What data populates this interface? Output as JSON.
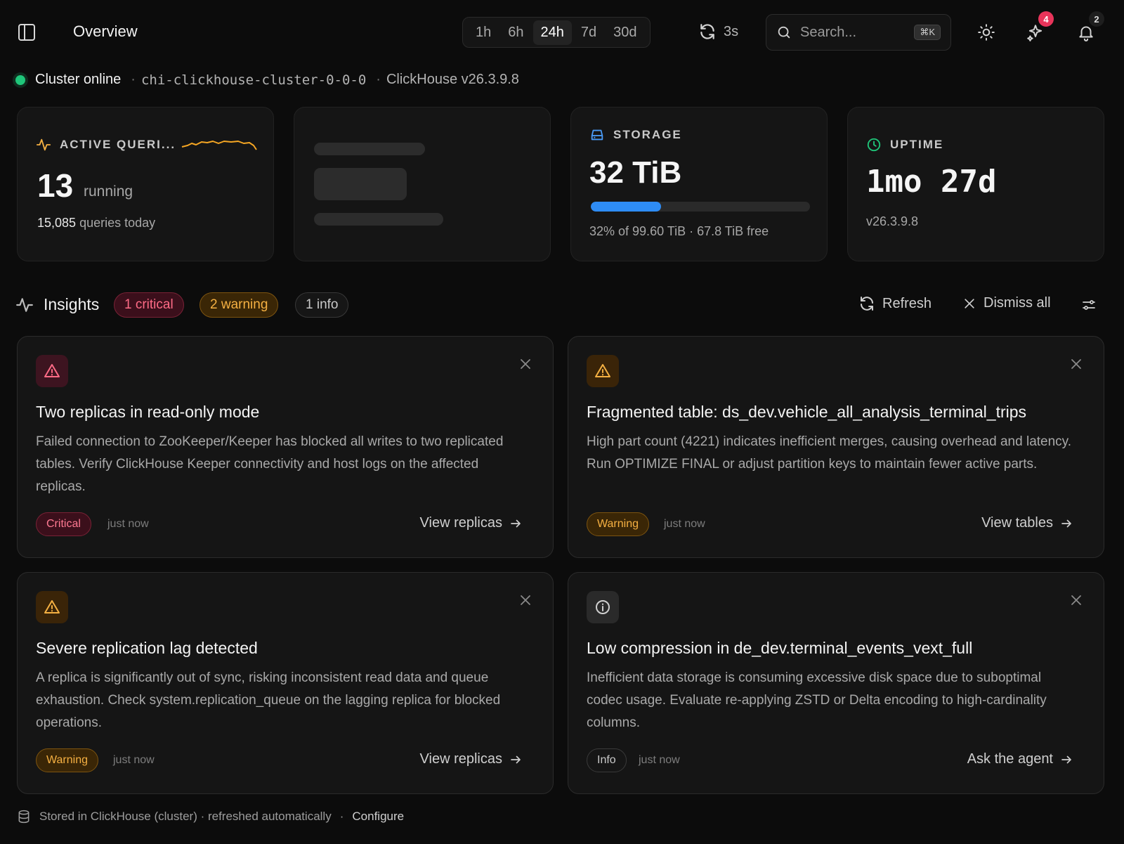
{
  "header": {
    "title": "Overview",
    "time_ranges": [
      "1h",
      "6h",
      "24h",
      "7d",
      "30d"
    ],
    "active_range": "24h",
    "refresh_rate": "3s",
    "search_placeholder": "Search...",
    "search_shortcut": "⌘K",
    "agent_badge": "4",
    "notification_badge": "2"
  },
  "status": {
    "state": "Cluster online",
    "host": "chi-clickhouse-cluster-0-0-0",
    "version": "ClickHouse v26.3.9.8"
  },
  "stats": {
    "active": {
      "label": "ACTIVE QUERI...",
      "value": "13",
      "unit": "running",
      "today_count": "15,085",
      "today_label": "queries today"
    },
    "storage": {
      "label": "STORAGE",
      "value": "32 TiB",
      "used_fraction": 0.32,
      "detail": "32% of 99.60 TiB · 67.8 TiB free"
    },
    "uptime": {
      "label": "UPTIME",
      "value": "1mo 27d",
      "version": "v26.3.9.8"
    }
  },
  "insights": {
    "title": "Insights",
    "counts": {
      "critical": "1 critical",
      "warning": "2 warning",
      "info": "1 info"
    },
    "refresh_label": "Refresh",
    "dismiss_label": "Dismiss all",
    "cards": [
      {
        "severity": "Critical",
        "title": "Two replicas in read-only mode",
        "description": "Failed connection to ZooKeeper/Keeper has blocked all writes to two replicated tables. Verify ClickHouse Keeper connectivity and host logs on the affected replicas.",
        "time": "just now",
        "action": "View replicas"
      },
      {
        "severity": "Warning",
        "title": "Fragmented table: ds_dev.vehicle_all_analysis_terminal_trips",
        "description": "High part count (4221) indicates inefficient merges, causing overhead and latency. Run OPTIMIZE FINAL or adjust partition keys to maintain fewer active parts.",
        "time": "just now",
        "action": "View tables"
      },
      {
        "severity": "Warning",
        "title": "Severe replication lag detected",
        "description": "A replica is significantly out of sync, risking inconsistent read data and queue exhaustion. Check system.replication_queue on the lagging replica for blocked operations.",
        "time": "just now",
        "action": "View replicas"
      },
      {
        "severity": "Info",
        "title": "Low compression in de_dev.terminal_events_vext_full",
        "description": "Inefficient data storage is consuming excessive disk space due to suboptimal codec usage. Evaluate re-applying ZSTD or Delta encoding to high-cardinality columns.",
        "time": "just now",
        "action": "Ask the agent"
      }
    ]
  },
  "footer": {
    "text": "Stored in ClickHouse (cluster) · refreshed automatically",
    "separator": "·",
    "configure": "Configure"
  },
  "colors": {
    "accent_blue": "#2e8cf5",
    "online_green": "#1fc77a",
    "critical": "#ff6b86",
    "warning": "#f5b042"
  }
}
